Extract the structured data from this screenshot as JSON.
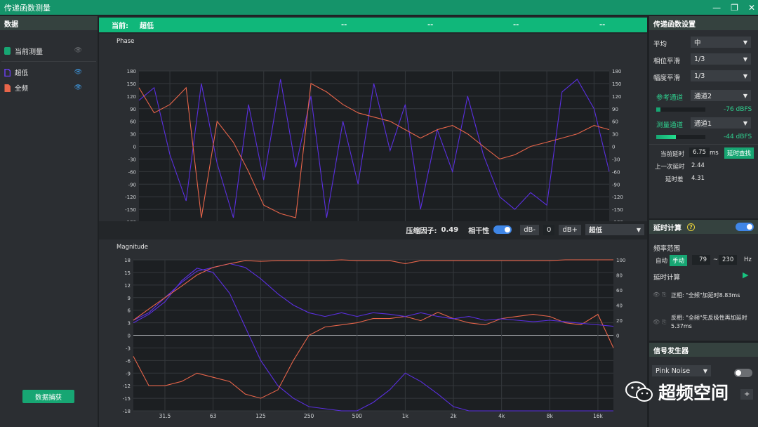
{
  "app": {
    "title": "传递函数测量"
  },
  "window_controls": {
    "minimize": "—",
    "restore": "❐",
    "close": "✕"
  },
  "left": {
    "header": "数据",
    "current_label": "当前测量",
    "items": [
      {
        "label": "超低",
        "color": "#6a3ff0"
      },
      {
        "label": "全频",
        "color": "#e8654a"
      }
    ],
    "capture_button": "数据捕获"
  },
  "center": {
    "current": {
      "label": "当前:",
      "name": "超低",
      "v1": "--",
      "v2": "--",
      "v3": "--",
      "v4": "--"
    },
    "phase_title": "Phase",
    "magnitude_title": "Magnitude",
    "controls": {
      "compression_label": "压缩因子:",
      "compression_value": "0.49",
      "coherence_label": "相干性",
      "db_minus": "dB-",
      "db_value": "0",
      "db_plus": "dB+",
      "select": "超低"
    }
  },
  "right": {
    "header": "传递函数设置",
    "average_label": "平均",
    "average_value": "中",
    "phase_smooth_label": "相位平滑",
    "phase_smooth_value": "1/3",
    "mag_smooth_label": "幅度平滑",
    "mag_smooth_value": "1/3",
    "ref_label": "参考通道",
    "ref_value": "通道2",
    "ref_level": "-76 dBFS",
    "meas_label": "测量通道",
    "meas_value": "通道1",
    "meas_level": "-44 dBFS",
    "cur_delay_label": "当前延时",
    "cur_delay_value": "6.75",
    "cur_delay_unit": "ms",
    "delay_find": "延时查找",
    "last_delay_label": "上一次延时",
    "last_delay_value": "2.44",
    "delay_diff_label": "延时差",
    "delay_diff_value": "4.31",
    "delay_calc_header": "延时计算",
    "freq_range_label": "频率范围",
    "auto": "自动",
    "manual": "手动",
    "f_low": "79",
    "tilde": "~",
    "f_high": "230",
    "hz": "Hz",
    "delay_calc_label": "延时计算",
    "pos_text": "正相: \"全频\"加延时8.83ms",
    "neg_text": "反相: \"全频\"先反极性再加延时5.37ms",
    "sig_header": "信号发生器",
    "sig_value": "Pink Noise",
    "plus": "+"
  },
  "watermark": "超频空间",
  "chart_data": [
    {
      "type": "line",
      "title": "Phase",
      "x_ticks": [
        "31.5",
        "63",
        "125",
        "250",
        "500",
        "1k",
        "2k",
        "4k",
        "8k",
        "16k"
      ],
      "y_ticks": [
        180,
        150,
        120,
        90,
        60,
        30,
        0,
        -30,
        -60,
        -90,
        -120,
        -150,
        -180
      ],
      "ylim": [
        -180,
        180
      ],
      "x_scale": "log",
      "series": [
        {
          "color": "#5a2fe0",
          "x": [
            20,
            25,
            31.5,
            40,
            50,
            63,
            80,
            100,
            125,
            160,
            200,
            250,
            315,
            400,
            500,
            630,
            800,
            1000,
            1250,
            1600,
            2000,
            2500,
            3150,
            4000,
            5000,
            6300,
            8000,
            10000,
            12500,
            16000,
            20000
          ],
          "y": [
            110,
            140,
            -20,
            -130,
            150,
            -40,
            -170,
            100,
            -80,
            160,
            -50,
            120,
            -170,
            60,
            -90,
            150,
            -10,
            100,
            -150,
            40,
            -60,
            120,
            -20,
            -120,
            -150,
            -110,
            -140,
            130,
            160,
            90,
            -60
          ]
        },
        {
          "color": "#e8654a",
          "x": [
            20,
            25,
            31.5,
            40,
            50,
            63,
            80,
            100,
            125,
            160,
            200,
            250,
            315,
            400,
            500,
            630,
            800,
            1000,
            1250,
            1600,
            2000,
            2500,
            3150,
            4000,
            5000,
            6300,
            8000,
            10000,
            12500,
            16000,
            20000
          ],
          "y": [
            140,
            80,
            100,
            140,
            -170,
            60,
            10,
            -60,
            -140,
            -160,
            -170,
            150,
            130,
            100,
            80,
            70,
            60,
            40,
            20,
            40,
            50,
            30,
            0,
            -30,
            -20,
            0,
            10,
            20,
            30,
            50,
            40
          ]
        }
      ]
    },
    {
      "type": "line",
      "title": "Magnitude",
      "x_ticks": [
        "31.5",
        "63",
        "125",
        "250",
        "500",
        "1k",
        "2k",
        "4k",
        "8k",
        "16k"
      ],
      "y_ticks": [
        18,
        15,
        12,
        9,
        6,
        3,
        0,
        -3,
        -6,
        -9,
        -12,
        -15,
        -18
      ],
      "y2_ticks": [
        100,
        80,
        60,
        40,
        20,
        0
      ],
      "ylim": [
        -18,
        18
      ],
      "x_scale": "log",
      "series": [
        {
          "color": "#5a2fe0",
          "x": [
            20,
            25,
            31.5,
            40,
            50,
            63,
            80,
            100,
            125,
            160,
            200,
            250,
            315,
            400,
            500,
            630,
            800,
            1000,
            1250,
            1600,
            2000,
            2500,
            3150,
            4000,
            5000,
            6300,
            8000,
            10000,
            12500,
            16000,
            20000
          ],
          "y": [
            3,
            5,
            8,
            13,
            16,
            15,
            10,
            2,
            -6,
            -12,
            -15,
            -17,
            -17.5,
            -18,
            -18,
            -16,
            -13,
            -9,
            -11,
            -14,
            -17,
            -18,
            -18,
            -18,
            -18,
            -18,
            -18,
            -18,
            -18,
            -18,
            -18
          ]
        },
        {
          "color": "#e8654a",
          "x": [
            20,
            25,
            31.5,
            40,
            50,
            63,
            80,
            100,
            125,
            160,
            200,
            250,
            315,
            400,
            500,
            630,
            800,
            1000,
            1250,
            1600,
            2000,
            2500,
            3150,
            4000,
            5000,
            6300,
            8000,
            10000,
            12500,
            16000,
            20000
          ],
          "y": [
            -5,
            -12,
            -12,
            -11,
            -9,
            -10,
            -11,
            -14,
            -15,
            -13,
            -6,
            0,
            2,
            2.5,
            3,
            4,
            4,
            4.5,
            3.5,
            5.5,
            4,
            3,
            2.5,
            4,
            4.5,
            5,
            4.5,
            3,
            2.5,
            5,
            -3
          ]
        },
        {
          "color": "#5a2fe0",
          "axis": "right",
          "x": [
            20,
            25,
            31.5,
            40,
            50,
            63,
            80,
            100,
            125,
            160,
            200,
            250,
            315,
            400,
            500,
            630,
            800,
            1000,
            1250,
            1600,
            2000,
            2500,
            3150,
            4000,
            5000,
            6300,
            8000,
            10000,
            12500,
            16000,
            20000
          ],
          "y": [
            20,
            30,
            50,
            70,
            85,
            90,
            95,
            90,
            75,
            55,
            40,
            30,
            25,
            30,
            25,
            30,
            28,
            25,
            30,
            25,
            22,
            25,
            20,
            22,
            20,
            18,
            20,
            18,
            16,
            14,
            12
          ]
        },
        {
          "color": "#e8654a",
          "axis": "right",
          "x": [
            20,
            25,
            31.5,
            40,
            50,
            63,
            80,
            100,
            125,
            160,
            200,
            250,
            315,
            400,
            500,
            630,
            800,
            1000,
            1250,
            1600,
            2000,
            2500,
            3150,
            4000,
            5000,
            6300,
            8000,
            10000,
            12500,
            16000,
            20000
          ],
          "y": [
            20,
            35,
            50,
            65,
            80,
            90,
            95,
            99,
            98,
            99,
            99,
            99,
            99,
            100,
            99,
            99,
            99,
            95,
            99,
            99,
            99,
            99,
            99,
            99,
            99,
            99,
            99,
            100,
            100,
            100,
            100
          ]
        }
      ]
    }
  ]
}
